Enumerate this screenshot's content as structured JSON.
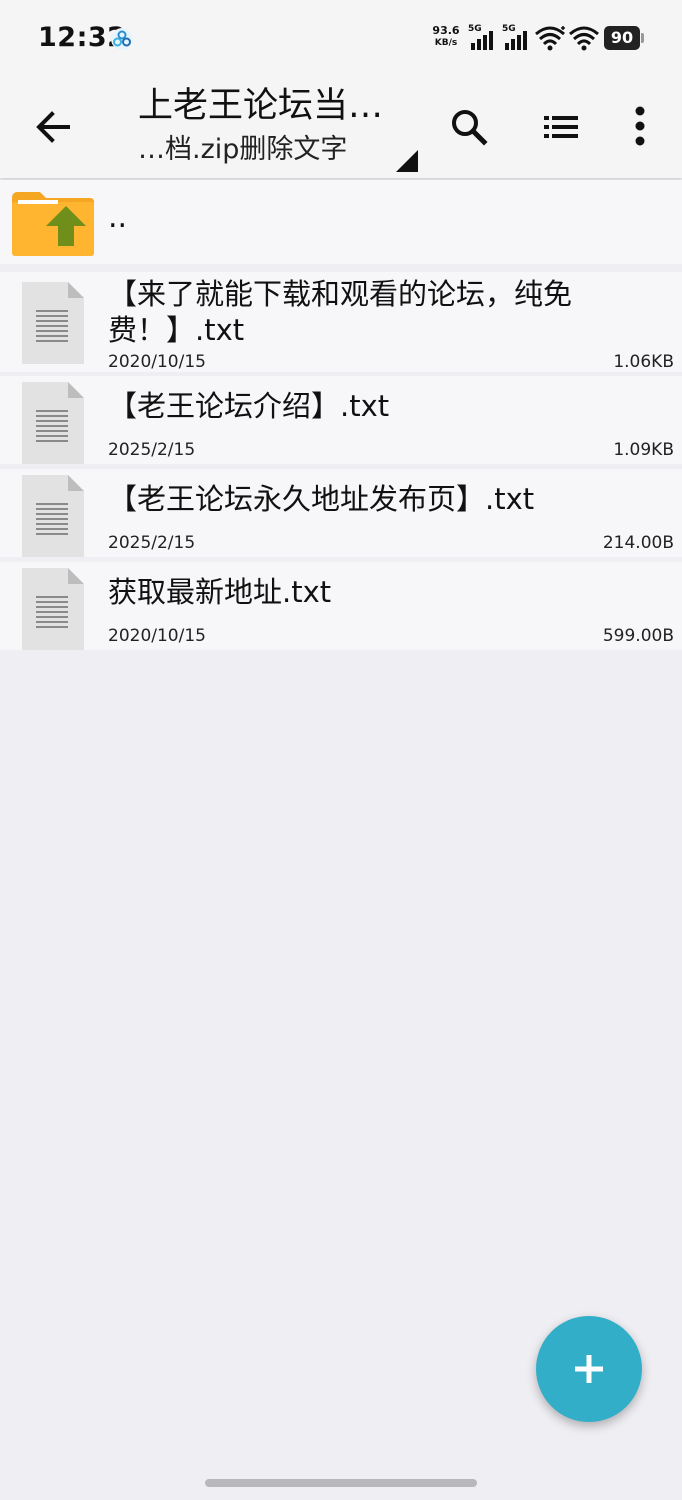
{
  "status_bar": {
    "time": "12:32",
    "net_speed_value": "93.6",
    "net_speed_unit": "KB/s",
    "signal_1_tag": "5G",
    "signal_2_tag": "5G",
    "battery_level": "90",
    "icons": [
      "app-badge-icon",
      "signal-icon",
      "signal-icon",
      "wifi-icon",
      "wifi-icon",
      "battery-icon"
    ]
  },
  "toolbar": {
    "title": "上老王论坛当…",
    "subtitle": "…档.zip删除文字",
    "icons": [
      "back-arrow-icon",
      "search-icon",
      "list-view-icon",
      "more-vert-icon",
      "dropdown-corner-icon"
    ]
  },
  "file_list": {
    "parent_label": "..",
    "items": [
      {
        "name": "【来了就能下载和观看的论坛，纯免费！】.txt",
        "date": "2020/10/15",
        "size": "1.06KB"
      },
      {
        "name": "【老王论坛介绍】.txt",
        "date": "2025/2/15",
        "size": "1.09KB"
      },
      {
        "name": "【老王论坛永久地址发布页】.txt",
        "date": "2025/2/15",
        "size": "214.00B"
      },
      {
        "name": "获取最新地址.txt",
        "date": "2020/10/15",
        "size": "599.00B"
      }
    ]
  },
  "fab": {
    "icon": "plus-icon"
  },
  "colors": {
    "background": "#efeef3",
    "accent": "#33aec9",
    "folder": "#f5a623",
    "folder_arrow": "#6f8f1a"
  }
}
